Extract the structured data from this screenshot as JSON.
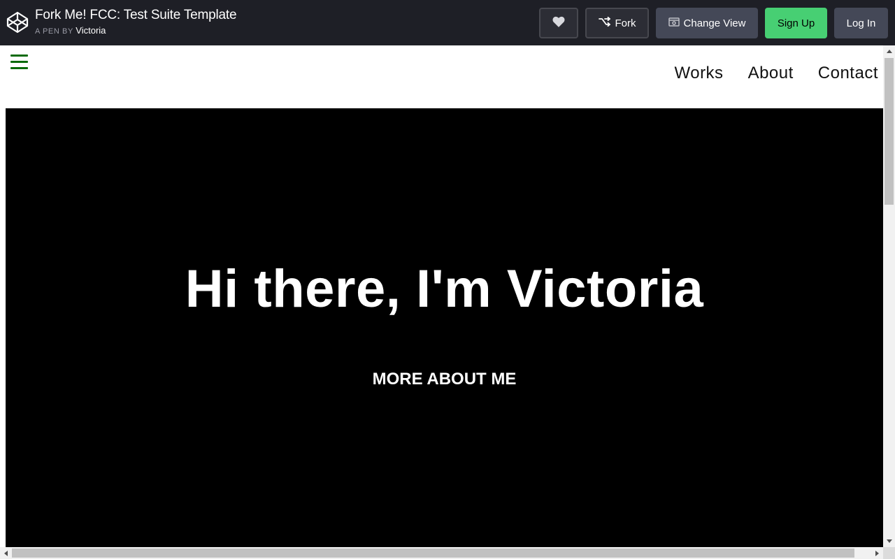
{
  "header": {
    "pen_title": "Fork Me! FCC: Test Suite Template",
    "byline_prefix": "A PEN BY",
    "author": "Victoria",
    "buttons": {
      "fork": "Fork",
      "change_view": "Change View",
      "sign_up": "Sign Up",
      "log_in": "Log In"
    },
    "icons": {
      "logo": "codepen-logo-icon",
      "heart": "heart-icon",
      "fork": "fork-icon",
      "change_view": "change-view-icon"
    }
  },
  "preview": {
    "nav": [
      "Works",
      "About",
      "Contact"
    ],
    "hero": {
      "title": "Hi there, I'm Victoria",
      "link": "MORE ABOUT ME"
    }
  },
  "colors": {
    "topbar_bg": "#1e1f26",
    "sign_up_bg": "#47cf73",
    "hamburger": "#0b6b0b",
    "hero_bg": "#000000"
  }
}
